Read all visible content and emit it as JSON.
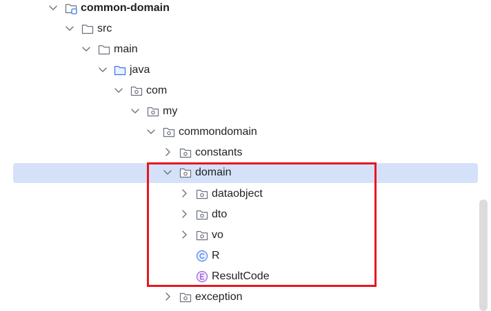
{
  "tree": {
    "module": "common-domain",
    "src": "src",
    "main": "main",
    "java": "java",
    "com": "com",
    "my": "my",
    "commondomain": "commondomain",
    "constants": "constants",
    "domain": "domain",
    "dataobject": "dataobject",
    "dto": "dto",
    "vo": "vo",
    "r_class": "R",
    "result_code_enum": "ResultCode",
    "exception": "exception"
  },
  "colors": {
    "selection": "#d5e1f9",
    "highlight_box": "#e8141e",
    "class_icon": "#4a84e8",
    "enum_icon": "#9a5ce0",
    "module_icon": "#3574f0"
  },
  "icons": {
    "module": "module-folder-icon",
    "folder": "folder-icon",
    "source_root": "source-root-folder-icon",
    "package": "package-icon",
    "class": "class-icon",
    "enum": "enum-icon"
  }
}
